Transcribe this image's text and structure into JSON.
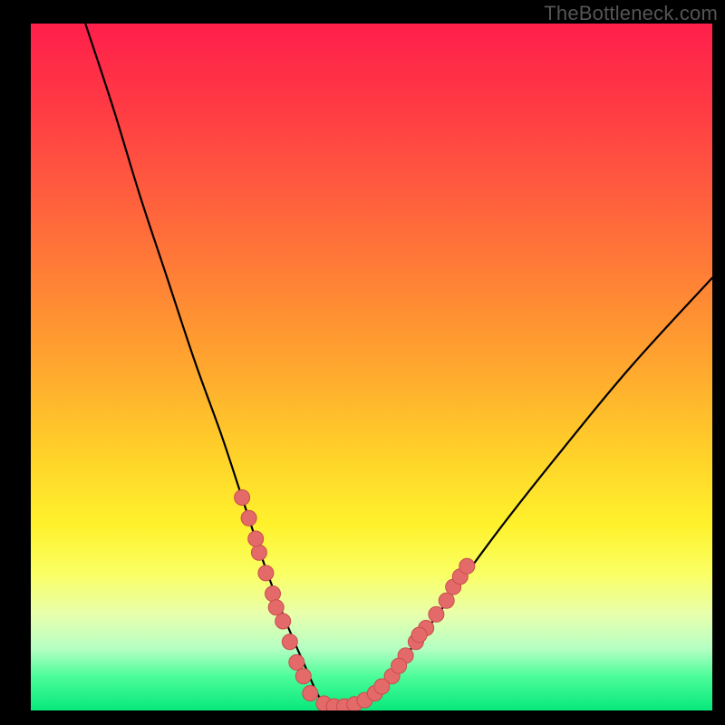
{
  "watermark": "TheBottleneck.com",
  "chart_data": {
    "type": "line",
    "title": "",
    "xlabel": "",
    "ylabel": "",
    "xlim": [
      0,
      100
    ],
    "ylim": [
      0,
      100
    ],
    "grid": false,
    "legend": false,
    "curve": {
      "note": "V-shaped bottleneck curve; minimum near x≈43 where it flattens at y≈0",
      "x": [
        8,
        12,
        16,
        20,
        24,
        28,
        31,
        34,
        37,
        40,
        43,
        46,
        49,
        52,
        55,
        59,
        64,
        70,
        78,
        88,
        100
      ],
      "y": [
        100,
        88,
        75,
        63,
        51,
        40,
        31,
        22,
        14,
        7,
        1,
        0.5,
        1.5,
        4,
        8,
        13,
        20,
        28,
        38,
        50,
        63
      ]
    },
    "markers": {
      "note": "scatter markers near bottom of V",
      "points": [
        {
          "x": 31,
          "y": 31
        },
        {
          "x": 32,
          "y": 28
        },
        {
          "x": 33.5,
          "y": 23
        },
        {
          "x": 34.5,
          "y": 20
        },
        {
          "x": 35.5,
          "y": 17
        },
        {
          "x": 37,
          "y": 13
        },
        {
          "x": 38,
          "y": 10
        },
        {
          "x": 40,
          "y": 5
        },
        {
          "x": 41,
          "y": 2.5
        },
        {
          "x": 43,
          "y": 1
        },
        {
          "x": 44.5,
          "y": 0.6
        },
        {
          "x": 46,
          "y": 0.6
        },
        {
          "x": 47.5,
          "y": 0.9
        },
        {
          "x": 49,
          "y": 1.5
        },
        {
          "x": 50.5,
          "y": 2.5
        },
        {
          "x": 53,
          "y": 5
        },
        {
          "x": 55,
          "y": 8
        },
        {
          "x": 56.5,
          "y": 10
        },
        {
          "x": 58,
          "y": 12
        },
        {
          "x": 59.5,
          "y": 14
        },
        {
          "x": 61,
          "y": 16
        },
        {
          "x": 62,
          "y": 18
        },
        {
          "x": 63,
          "y": 19.5
        },
        {
          "x": 64,
          "y": 21
        },
        {
          "x": 33,
          "y": 25
        },
        {
          "x": 36,
          "y": 15
        },
        {
          "x": 39,
          "y": 7
        },
        {
          "x": 51.5,
          "y": 3.5
        },
        {
          "x": 54,
          "y": 6.5
        },
        {
          "x": 57,
          "y": 11
        }
      ]
    },
    "background_gradient": {
      "top": "#ff1f4b",
      "mid": "#ffe033",
      "bottom": "#07e87b"
    }
  }
}
